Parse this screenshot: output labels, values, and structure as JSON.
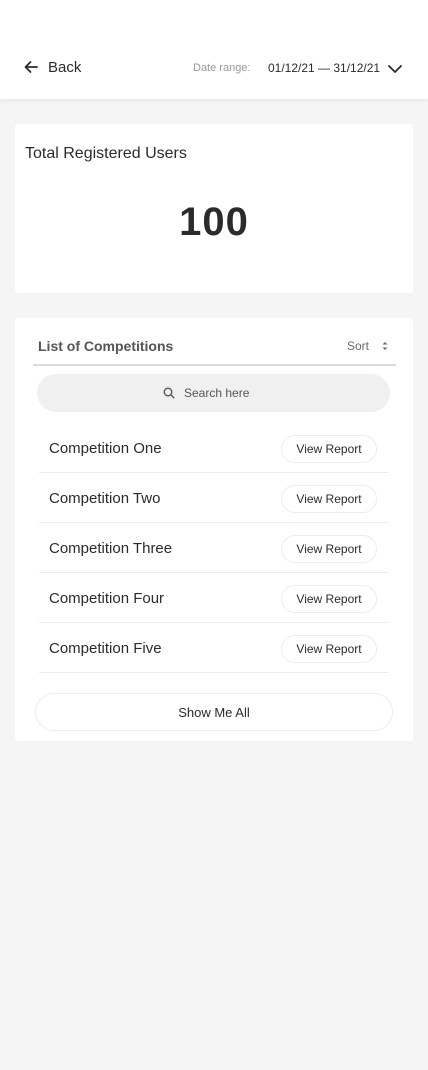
{
  "header": {
    "back_label": "Back",
    "date_range_label": "Date range:",
    "date_range_value": "01/12/21 — 31/12/21"
  },
  "users_card": {
    "title": "Total Registered Users",
    "count": "100"
  },
  "competitions": {
    "title": "List of Competitions",
    "sort_label": "Sort",
    "search_placeholder": "Search here",
    "items": [
      {
        "name": "Competition One",
        "action": "View Report"
      },
      {
        "name": "Competition Two",
        "action": "View Report"
      },
      {
        "name": "Competition Three",
        "action": "View Report"
      },
      {
        "name": "Competition Four",
        "action": "View Report"
      },
      {
        "name": "Competition Five",
        "action": "View Report"
      }
    ],
    "show_all_label": "Show Me All"
  },
  "icons": {
    "back": "arrow-left-icon",
    "date": "chevron-down-icon",
    "sort": "sort-arrows-icon",
    "search": "search-icon"
  },
  "colors": {
    "background": "#f5f5f5",
    "card": "#ffffff",
    "text": "#2b2b2b",
    "muted": "#9a9a9a"
  }
}
